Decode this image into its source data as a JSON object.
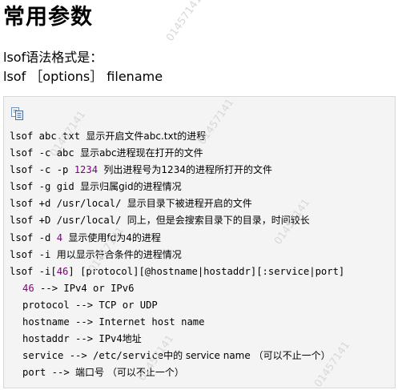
{
  "title": "常用参数",
  "intro": {
    "line1": "lsof语法格式是：",
    "line2": "lsof ［options］ filename"
  },
  "watermark": "01457141",
  "code_lines": [
    {
      "cmd": "lsof abc.txt ",
      "num": "",
      "rest": "",
      "desc": "显示开启文件abc.txt的进程"
    },
    {
      "cmd": "lsof -c abc ",
      "num": "",
      "rest": "",
      "desc": "显示abc进程现在打开的文件"
    },
    {
      "cmd": "lsof -c -p ",
      "num": "1234",
      "rest": " ",
      "desc": "列出进程号为1234的进程所打开的文件"
    },
    {
      "cmd": "lsof -g gid ",
      "num": "",
      "rest": "",
      "desc": "显示归属gid的进程情况"
    },
    {
      "cmd": "lsof +d /usr/local/ ",
      "num": "",
      "rest": "",
      "desc": "显示目录下被进程开启的文件"
    },
    {
      "cmd": "lsof +D /usr/local/ ",
      "num": "",
      "rest": "",
      "desc": "同上，但是会搜索目录下的目录，时间较长"
    },
    {
      "cmd": "lsof -d ",
      "num": "4",
      "rest": " ",
      "desc": "显示使用fd为4的进程"
    },
    {
      "cmd": "lsof -i ",
      "num": "",
      "rest": "",
      "desc": "用以显示符合条件的进程情况"
    },
    {
      "cmd": "lsof -i[",
      "num": "46",
      "rest": "] [protocol][@hostname|hostaddr][:service|port]",
      "desc": ""
    },
    {
      "cmd": "",
      "num": "46",
      "rest": " --> IPv4 or IPv6",
      "desc": "",
      "indent": true
    },
    {
      "cmd": "protocol --> TCP or UDP",
      "num": "",
      "rest": "",
      "desc": "",
      "indent": true
    },
    {
      "cmd": "hostname --> Internet host name",
      "num": "",
      "rest": "",
      "desc": "",
      "indent": true
    },
    {
      "cmd": "hostaddr --> IPv4",
      "num": "",
      "rest": "",
      "desc": "地址",
      "indent": true
    },
    {
      "cmd": "service --> /etc/service",
      "num": "",
      "rest": "",
      "desc": "中的 service name （可以不止一个）",
      "indent": true
    },
    {
      "cmd": "port --> ",
      "num": "",
      "rest": "",
      "desc": "端口号 （可以不止一个）",
      "indent": true
    }
  ]
}
